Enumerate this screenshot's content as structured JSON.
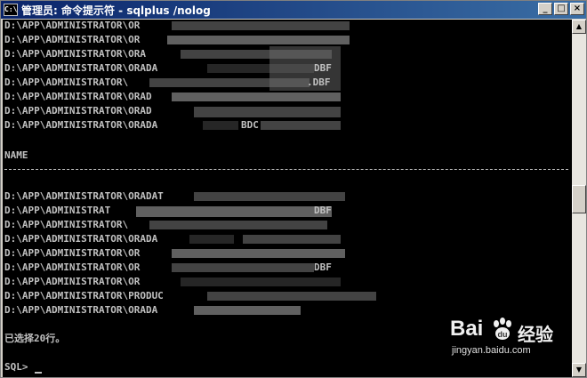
{
  "window": {
    "title": "管理员: 命令提示符 - sqlplus /nolog",
    "icon_text": "C:\\",
    "minimize": "_",
    "maximize": "□",
    "close": "×"
  },
  "console": {
    "lines_top": [
      "D:\\APP\\ADMINISTRATOR\\OR",
      "D:\\APP\\ADMINISTRATOR\\OR",
      "D:\\APP\\ADMINISTRATOR\\ORA",
      "D:\\APP\\ADMINISTRATOR\\ORADA",
      "D:\\APP\\ADMINISTRATOR\\",
      "D:\\APP\\ADMINISTRATOR\\ORAD",
      "D:\\APP\\ADMINISTRATOR\\ORAD",
      "D:\\APP\\ADMINISTRATOR\\ORADA"
    ],
    "frag_top": [
      {
        "text": "",
        "row": 0
      },
      {
        "text": "",
        "row": 1
      },
      {
        "text": "",
        "row": 2
      },
      {
        "text": "DBF",
        "row": 3
      },
      {
        "text": ".DBF",
        "row": 4
      },
      {
        "text": "",
        "row": 5
      },
      {
        "text": "",
        "row": 6
      },
      {
        "text": "BDC",
        "row": 7
      }
    ],
    "column_header": "NAME",
    "lines_bottom": [
      "D:\\APP\\ADMINISTRATOR\\ORADAT",
      "D:\\APP\\ADMINISTRAT",
      "D:\\APP\\ADMINISTRATOR\\",
      "D:\\APP\\ADMINISTRATOR\\ORADA",
      "D:\\APP\\ADMINISTRATOR\\OR",
      "D:\\APP\\ADMINISTRATOR\\OR",
      "D:\\APP\\ADMINISTRATOR\\OR",
      "D:\\APP\\ADMINISTRATOR\\PRODUC",
      "D:\\APP\\ADMINISTRATOR\\ORADA"
    ],
    "frag_bottom": [
      {
        "text": "",
        "row": 0
      },
      {
        "text": "DBF",
        "row": 1
      },
      {
        "text": "",
        "row": 2
      },
      {
        "text": "",
        "row": 3
      },
      {
        "text": "",
        "row": 4
      },
      {
        "text": "DBF",
        "row": 5
      },
      {
        "text": "",
        "row": 6
      },
      {
        "text": "",
        "row": 7
      },
      {
        "text": "",
        "row": 8
      }
    ],
    "result": "已选择20行。",
    "prompt": "SQL> "
  },
  "scrollbar": {
    "up": "▲",
    "down": "▼"
  },
  "watermark": {
    "brand": "Bai",
    "brand_cn": "经验",
    "url": "jingyan.baidu.com"
  }
}
